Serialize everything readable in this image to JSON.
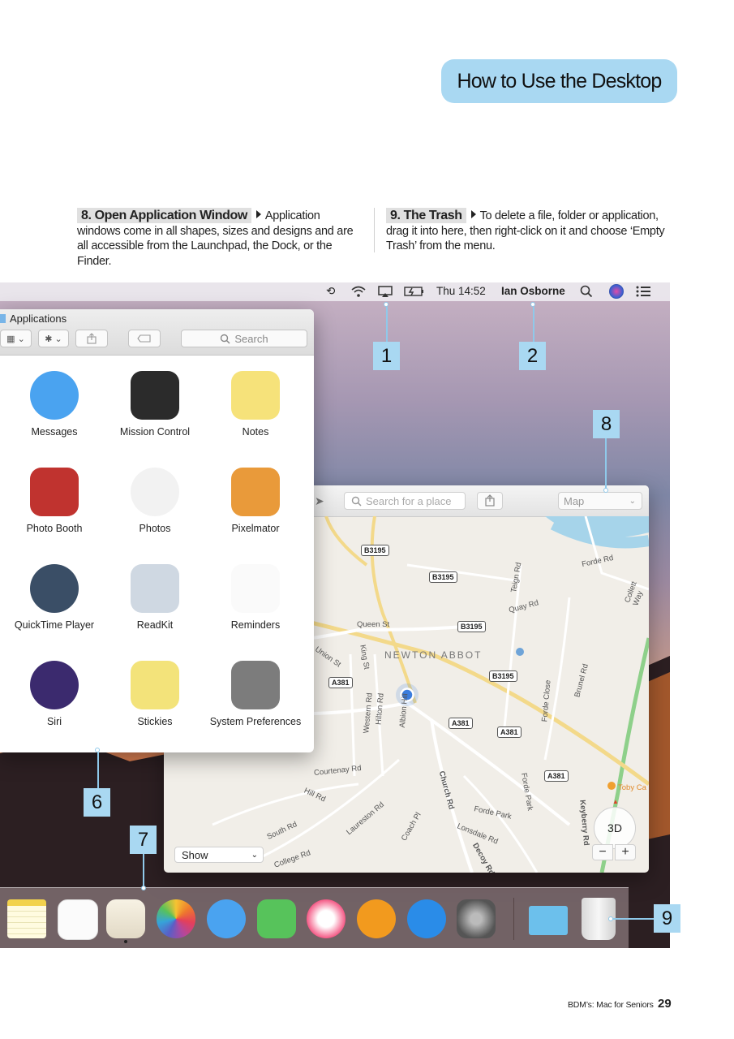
{
  "header": {
    "tab_title": "How to Use the Desktop"
  },
  "steps": [
    {
      "title": "8. Open Application Window",
      "body": "Application windows come in all shapes, sizes and designs and are all accessible from the Launchpad, the Dock, or the Finder."
    },
    {
      "title": "9. The Trash",
      "body": "To delete a file, folder or application, drag it into here, then right-click on it and choose ‘Empty Trash’ from the menu."
    }
  ],
  "menubar": {
    "clock": "Thu 14:52",
    "user": "Ian Osborne"
  },
  "finder": {
    "title": "Applications",
    "search_placeholder": "Search",
    "apps": [
      {
        "label": "Messages",
        "color": "#4aa3f0"
      },
      {
        "label": "Mission Control",
        "color": "#2b2b2b"
      },
      {
        "label": "Notes",
        "color": "#f6e27a"
      },
      {
        "label": "Photo Booth",
        "color": "#c0332f"
      },
      {
        "label": "Photos",
        "color": "#f2f2f2"
      },
      {
        "label": "Pixelmator",
        "color": "#e99a3a"
      },
      {
        "label": "QuickTime Player",
        "color": "#3a4e66"
      },
      {
        "label": "ReadKit",
        "color": "#cfd8e2"
      },
      {
        "label": "Reminders",
        "color": "#fafafa"
      },
      {
        "label": "Siri",
        "color": "#3b2a6e"
      },
      {
        "label": "Stickies",
        "color": "#f3e37a"
      },
      {
        "label": "System Preferences",
        "color": "#7c7c7c"
      }
    ]
  },
  "maps": {
    "search_placeholder": "Search for a place",
    "map_type": "Map",
    "show_label": "Show",
    "btn_3d": "3D",
    "zoom_out": "−",
    "zoom_in": "+",
    "town": "NEWTON ABBOT",
    "roads": {
      "queen_st": "Queen St",
      "union_st": "Union St",
      "king_st": "King St",
      "forde_rd": "Forde Rd",
      "quay_rd": "Quay Rd",
      "teign_rd": "Teign Rd",
      "collett_way": "Collett Way",
      "brunel_rd": "Brunel Rd",
      "forde_close": "Forde Close",
      "western_rd": "Western Rd",
      "hilton_rd": "Hilton Rd",
      "albion_hill": "Albion Hill",
      "courtenay_rd": "Courtenay Rd",
      "hill_rd": "Hill Rd",
      "south_rd": "South Rd",
      "laureston_rd": "Laureston Rd",
      "coach_pl": "Coach Pl",
      "church_rd": "Church Rd",
      "college_rd": "College Rd",
      "forde_park": "Forde Park",
      "lonsdale_rd": "Lonsdale Rd",
      "decoy_rd": "Decoy Rd",
      "keyberry_rd": "Keyberry Rd",
      "toby_ca": "Toby Ca"
    },
    "shields": {
      "b3195": "B3195",
      "a381": "A381"
    }
  },
  "callouts": [
    "1",
    "2",
    "8",
    "6",
    "7",
    "9"
  ],
  "footer": {
    "publication": "BDM’s: Mac for Seniors",
    "page_number": "29"
  },
  "colors": {
    "accent": "#a9d8f2"
  }
}
